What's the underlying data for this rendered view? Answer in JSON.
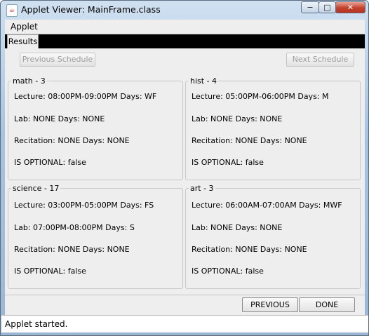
{
  "window": {
    "title": "Applet Viewer: MainFrame.class",
    "icon": "java-cup-icon",
    "min_glyph": "−",
    "max_glyph": "□",
    "close_glyph": "✕"
  },
  "menu": {
    "applet": "Applet"
  },
  "tabs": [
    {
      "label": "Results",
      "selected": true
    }
  ],
  "nav": {
    "previous_schedule": "Previous Schedule",
    "next_schedule": "Next Schedule",
    "previous_schedule_enabled": false,
    "next_schedule_enabled": false
  },
  "courses": [
    {
      "title": "math - 3",
      "lecture": "Lecture: 08:00PM-09:00PM  Days:  WF",
      "lab": "Lab: NONE  Days:  NONE",
      "recitation": "Recitation: NONE  Days:  NONE",
      "optional": "IS OPTIONAL:  false"
    },
    {
      "title": "hist - 4",
      "lecture": "Lecture: 05:00PM-06:00PM  Days:  M",
      "lab": "Lab: NONE  Days:  NONE",
      "recitation": "Recitation: NONE  Days:  NONE",
      "optional": "IS OPTIONAL:  false"
    },
    {
      "title": "science - 17",
      "lecture": "Lecture: 03:00PM-05:00PM  Days:  FS",
      "lab": "Lab: 07:00PM-08:00PM  Days:  S",
      "recitation": "Recitation: NONE  Days:  NONE",
      "optional": "IS OPTIONAL:  false"
    },
    {
      "title": "art - 3",
      "lecture": "Lecture: 06:00AM-07:00AM  Days:  MWF",
      "lab": "Lab: NONE  Days:  NONE",
      "recitation": "Recitation: NONE  Days:  NONE",
      "optional": "IS OPTIONAL:  false"
    }
  ],
  "actions": {
    "previous": "PREVIOUS",
    "done": "DONE"
  },
  "status": "Applet started."
}
